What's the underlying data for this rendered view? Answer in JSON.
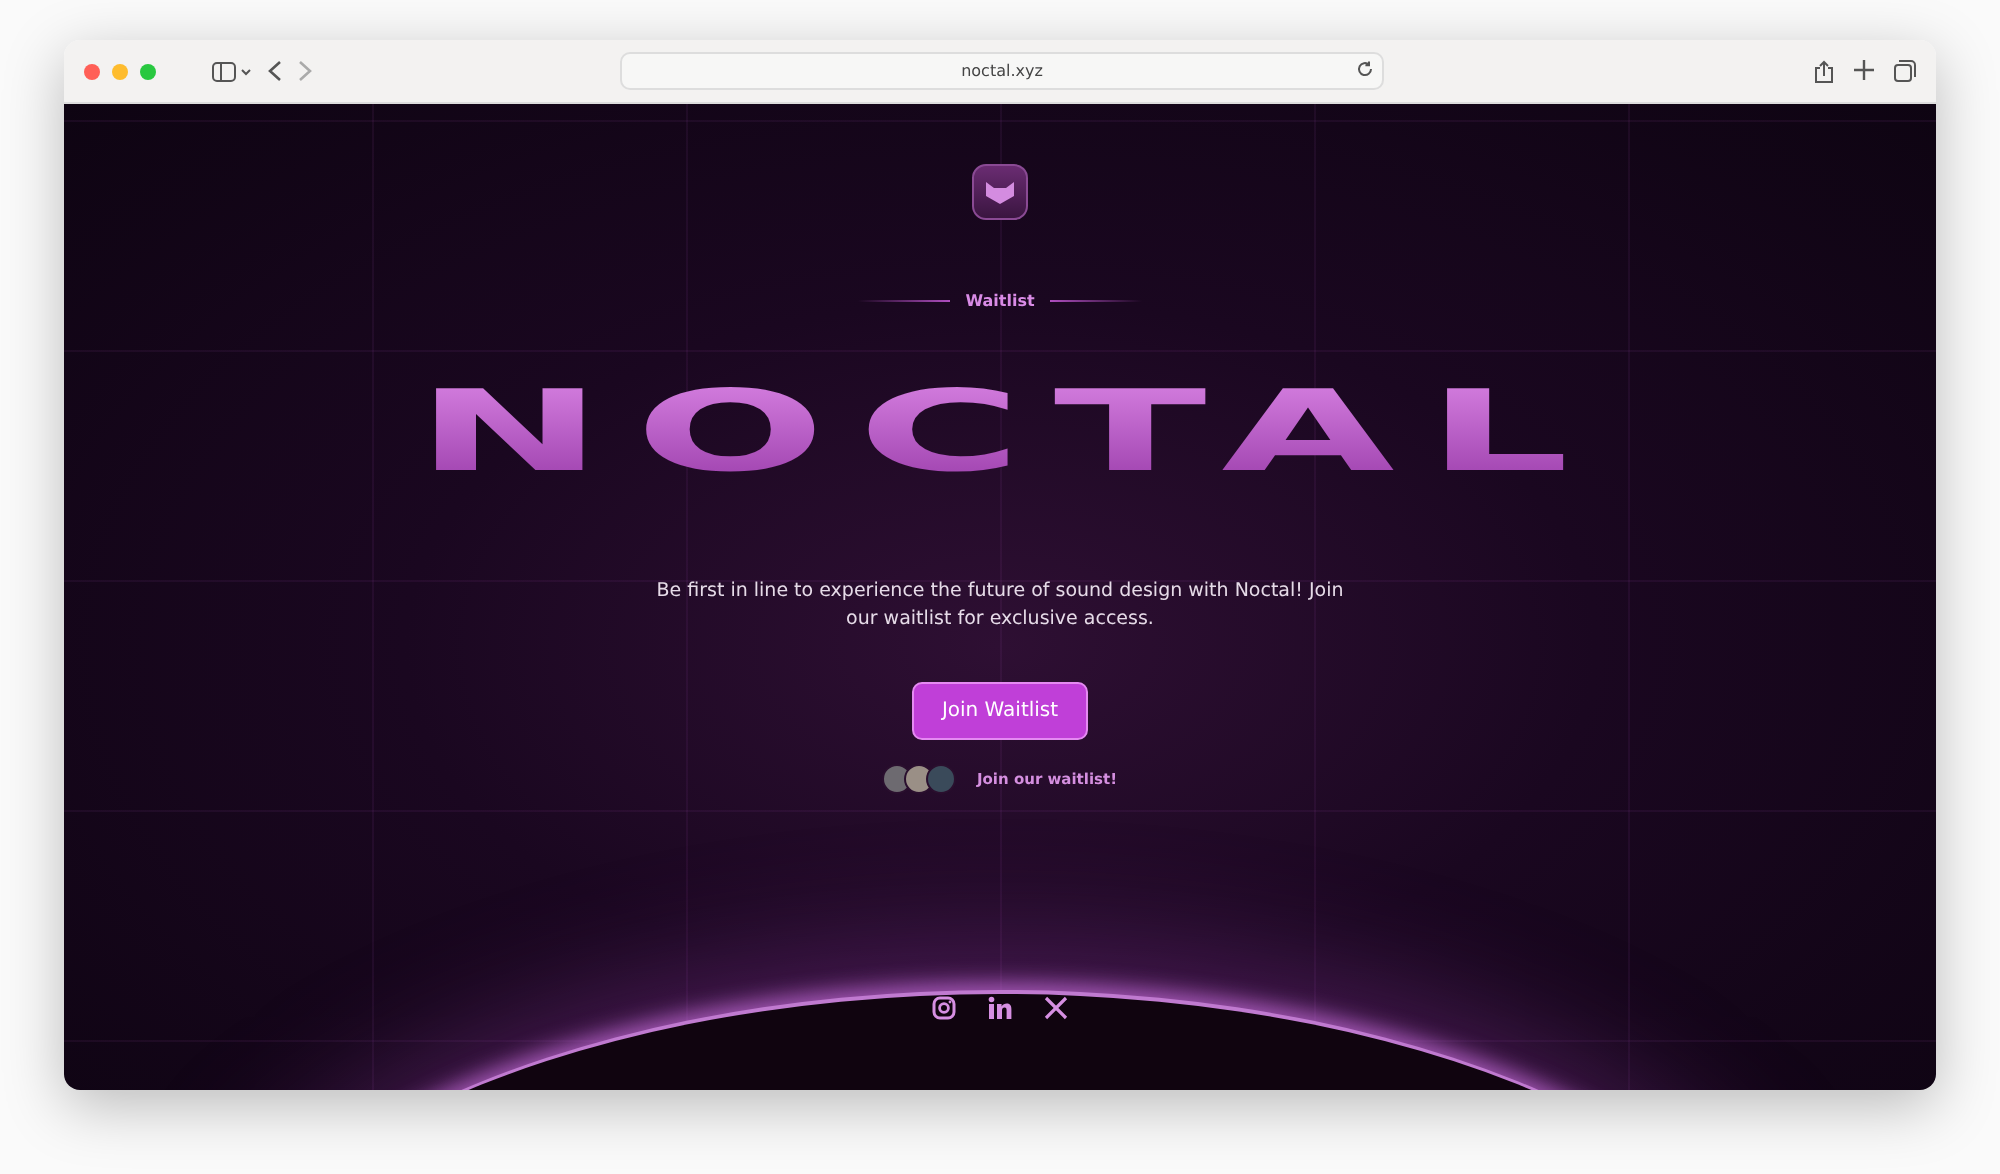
{
  "browser": {
    "url": "noctal.xyz"
  },
  "badge": "Waitlist",
  "title": "NOCTAL",
  "tagline": "Be first in line to experience the future of sound design with Noctal! Join our waitlist for exclusive access.",
  "cta": "Join Waitlist",
  "social_proof": {
    "label": "Join our waitlist!"
  }
}
